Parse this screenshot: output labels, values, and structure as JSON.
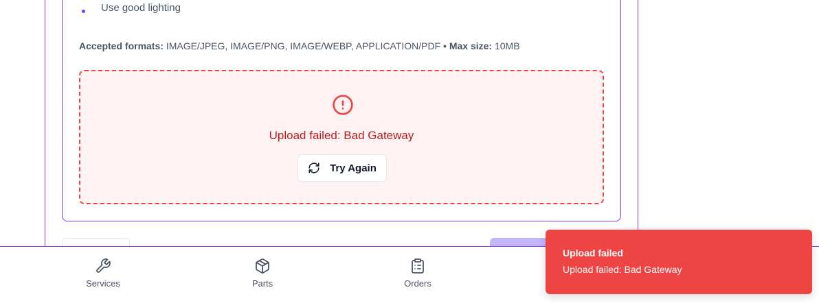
{
  "tips": {
    "last_item": "Use good lighting"
  },
  "formats": {
    "accepted_label": "Accepted formats:",
    "accepted_value": "IMAGE/JPEG, IMAGE/PNG, IMAGE/WEBP, APPLICATION/PDF",
    "separator": "•",
    "max_size_label": "Max size:",
    "max_size_value": "10MB"
  },
  "upload": {
    "error_message": "Upload failed: Bad Gateway",
    "retry_label": "Try Again",
    "icon": "alert-circle-icon"
  },
  "bottom_nav": {
    "items": [
      {
        "label": "Services",
        "icon": "wrench-icon"
      },
      {
        "label": "Parts",
        "icon": "box-icon"
      },
      {
        "label": "Orders",
        "icon": "clipboard-list-icon"
      }
    ]
  },
  "toast": {
    "title": "Upload failed",
    "description": "Upload failed: Bad Gateway"
  },
  "colors": {
    "accent": "#7c3aed",
    "error": "#ef4444",
    "error_text": "#b91c1c",
    "error_bg": "#fef2f2"
  }
}
